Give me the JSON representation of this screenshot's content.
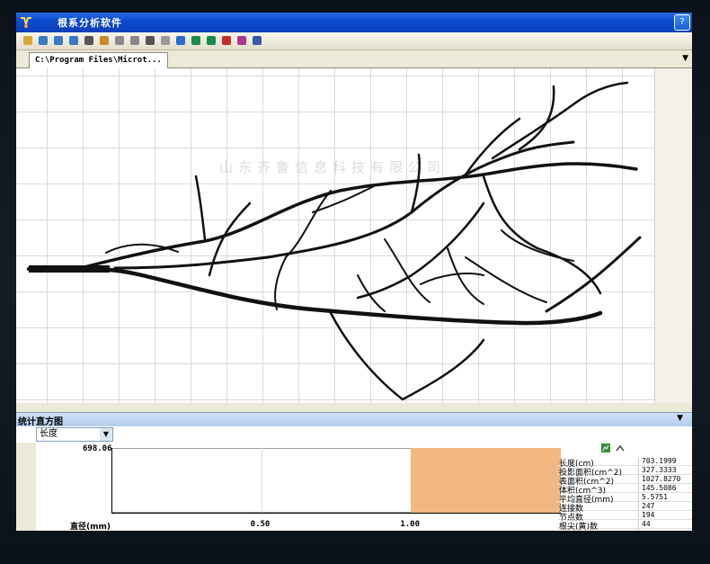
{
  "window": {
    "title": "根系分析软件",
    "help": "?"
  },
  "toolbar": {
    "icons": [
      "open-icon",
      "zoom-in-icon",
      "zoom-out-icon",
      "zoom-icon",
      "fit-icon",
      "measure-icon",
      "undo-icon",
      "redo-icon",
      "hand-icon",
      "play-icon",
      "pencil-icon",
      "root-edit-icon",
      "root-add-icon",
      "root-cut-icon",
      "paint-icon",
      "export-icon"
    ]
  },
  "tab": {
    "label": "C:\\Program Files\\Microt..."
  },
  "canvas": {
    "watermark": "山东齐鲁信息科技有限公司"
  },
  "panel": {
    "title": "统计直方图",
    "select_value": "长度"
  },
  "histogram": {
    "y_max": "698.06",
    "x_label": "直径(mm)",
    "ticks": [
      "0.50",
      "1.00"
    ]
  },
  "chart_data": {
    "type": "bar",
    "xlabel": "直径(mm)",
    "ylabel": "",
    "ylim": [
      0,
      698.06
    ],
    "bins": [
      {
        "from": 1.0,
        "to": 1.5,
        "value": 698.06
      }
    ],
    "xlim": [
      0,
      1.5
    ]
  },
  "stats": [
    {
      "label": "长度(cm)",
      "value": "703.1999"
    },
    {
      "label": "投影面积(cm^2)",
      "value": "327.3333"
    },
    {
      "label": "表面积(cm^2)",
      "value": "1027.8270"
    },
    {
      "label": "体积(cm^3)",
      "value": "145.5086"
    },
    {
      "label": "平均直径(mm)",
      "value": "5.5751"
    },
    {
      "label": "连接数",
      "value": "247"
    },
    {
      "label": "节点数",
      "value": "194"
    },
    {
      "label": "根尖(黄)数",
      "value": "44"
    }
  ],
  "colors": {
    "titlebar": "#0a4ad0",
    "hist_bar": "#f0b783",
    "root": "#111111"
  }
}
